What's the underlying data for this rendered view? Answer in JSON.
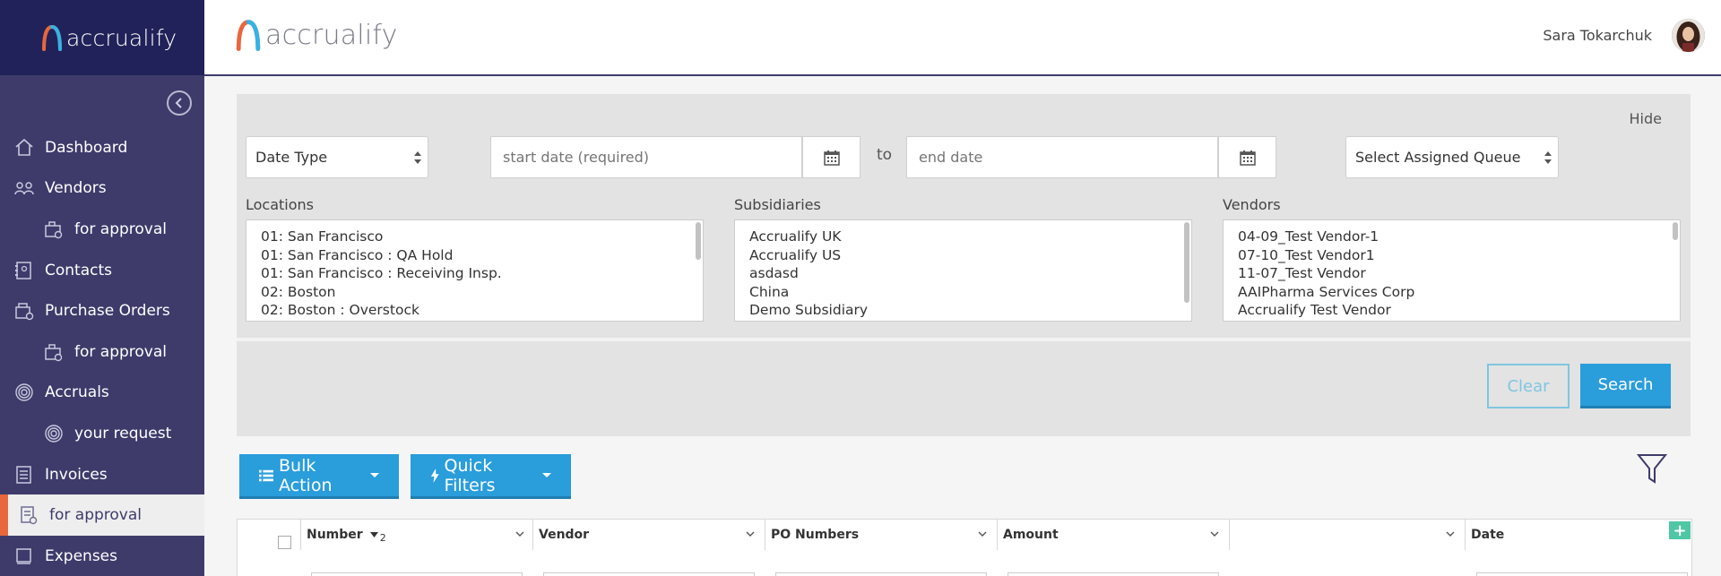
{
  "app": {
    "brand": "accrualify"
  },
  "sidebar": {
    "items": [
      {
        "label": "Dashboard",
        "icon": "home-icon",
        "level": 0,
        "active": false
      },
      {
        "label": "Vendors",
        "icon": "users-icon",
        "level": 0,
        "active": false
      },
      {
        "label": "for approval",
        "icon": "stamp-icon",
        "level": 1,
        "active": false
      },
      {
        "label": "Contacts",
        "icon": "contacts-icon",
        "level": 0,
        "active": false
      },
      {
        "label": "Purchase Orders",
        "icon": "cart-icon",
        "level": 0,
        "active": false
      },
      {
        "label": "for approval",
        "icon": "stamp-icon",
        "level": 1,
        "active": false
      },
      {
        "label": "Accruals",
        "icon": "target-icon",
        "level": 0,
        "active": false
      },
      {
        "label": "your request",
        "icon": "target-icon",
        "level": 1,
        "active": false
      },
      {
        "label": "Invoices",
        "icon": "invoice-icon",
        "level": 0,
        "active": false
      },
      {
        "label": "for approval",
        "icon": "invoice-approval-icon",
        "level": 1,
        "active": true
      },
      {
        "label": "Expenses",
        "icon": "expenses-icon",
        "level": 0,
        "active": false
      }
    ]
  },
  "header": {
    "user_name": "Sara Tokarchuk"
  },
  "filters": {
    "hide_label": "Hide",
    "date_type": "Date Type",
    "start_placeholder": "start date (required)",
    "to_label": "to",
    "end_placeholder": "end date",
    "queue": "Select Assigned Queue",
    "locations": {
      "label": "Locations",
      "options": [
        "01: San Francisco",
        "01: San Francisco : QA Hold",
        "01: San Francisco : Receiving Insp.",
        "02: Boston",
        "02: Boston : Overstock"
      ]
    },
    "subsidiaries": {
      "label": "Subsidiaries",
      "options": [
        "Accrualify UK",
        "Accrualify US",
        "asdasd",
        "China",
        "Demo Subsidiary"
      ]
    },
    "vendors": {
      "label": "Vendors",
      "options": [
        "04-09_Test Vendor-1",
        "07-10_Test Vendor1",
        "11-07_Test Vendor",
        "AAIPharma Services Corp",
        "Accrualify Test Vendor"
      ]
    },
    "clear_label": "Clear",
    "search_label": "Search"
  },
  "toolbar": {
    "bulk_action": "Bulk Action",
    "quick_filters": "Quick Filters"
  },
  "table": {
    "columns": [
      {
        "label": "Number",
        "sort_order": "2"
      },
      {
        "label": "Vendor"
      },
      {
        "label": "PO Numbers"
      },
      {
        "label": "Amount"
      },
      {
        "label": ""
      },
      {
        "label": "Date"
      }
    ],
    "add_column": "+"
  },
  "colors": {
    "sidebar_bg": "#3e3b6b",
    "sidebar_logo_bg": "#22225a",
    "accent_blue": "#2a9ddb",
    "active_marker": "#e8673c",
    "add_column_green": "#4fc7a4"
  }
}
